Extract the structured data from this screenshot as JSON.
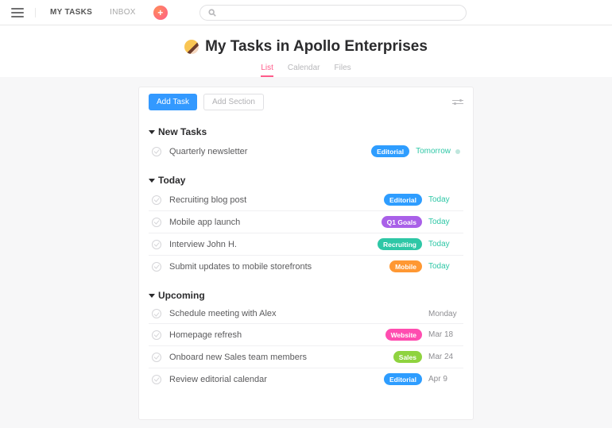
{
  "nav": {
    "my_tasks": "MY TASKS",
    "inbox": "INBOX"
  },
  "header": {
    "title": "My Tasks in Apollo Enterprises",
    "tabs": {
      "list": "List",
      "calendar": "Calendar",
      "files": "Files"
    }
  },
  "panel": {
    "add_task": "Add Task",
    "add_section": "Add Section"
  },
  "sections": {
    "new_tasks": {
      "title": "New Tasks",
      "items": [
        {
          "name": "Quarterly newsletter",
          "tag": "Editorial",
          "tag_class": "tag-blue",
          "date": "Tomorrow",
          "date_class": "date-teal",
          "has_dot": true
        }
      ]
    },
    "today": {
      "title": "Today",
      "items": [
        {
          "name": "Recruiting blog post",
          "tag": "Editorial",
          "tag_class": "tag-blue",
          "date": "Today",
          "date_class": "date-teal"
        },
        {
          "name": "Mobile app launch",
          "tag": "Q1 Goals",
          "tag_class": "tag-purple",
          "date": "Today",
          "date_class": "date-teal"
        },
        {
          "name": "Interview John H.",
          "tag": "Recruiting",
          "tag_class": "tag-teal",
          "date": "Today",
          "date_class": "date-teal"
        },
        {
          "name": "Submit updates to mobile storefronts",
          "tag": "Mobile",
          "tag_class": "tag-orange",
          "date": "Today",
          "date_class": "date-teal"
        }
      ]
    },
    "upcoming": {
      "title": "Upcoming",
      "items": [
        {
          "name": "Schedule meeting with Alex",
          "tag": "",
          "tag_class": "",
          "date": "Monday",
          "date_class": "date-grey"
        },
        {
          "name": "Homepage refresh",
          "tag": "Website",
          "tag_class": "tag-pink",
          "date": "Mar 18",
          "date_class": "date-grey"
        },
        {
          "name": "Onboard new Sales team members",
          "tag": "Sales",
          "tag_class": "tag-lime",
          "date": "Mar 24",
          "date_class": "date-grey"
        },
        {
          "name": "Review editorial calendar",
          "tag": "Editorial",
          "tag_class": "tag-blue",
          "date": "Apr 9",
          "date_class": "date-grey"
        }
      ]
    }
  }
}
